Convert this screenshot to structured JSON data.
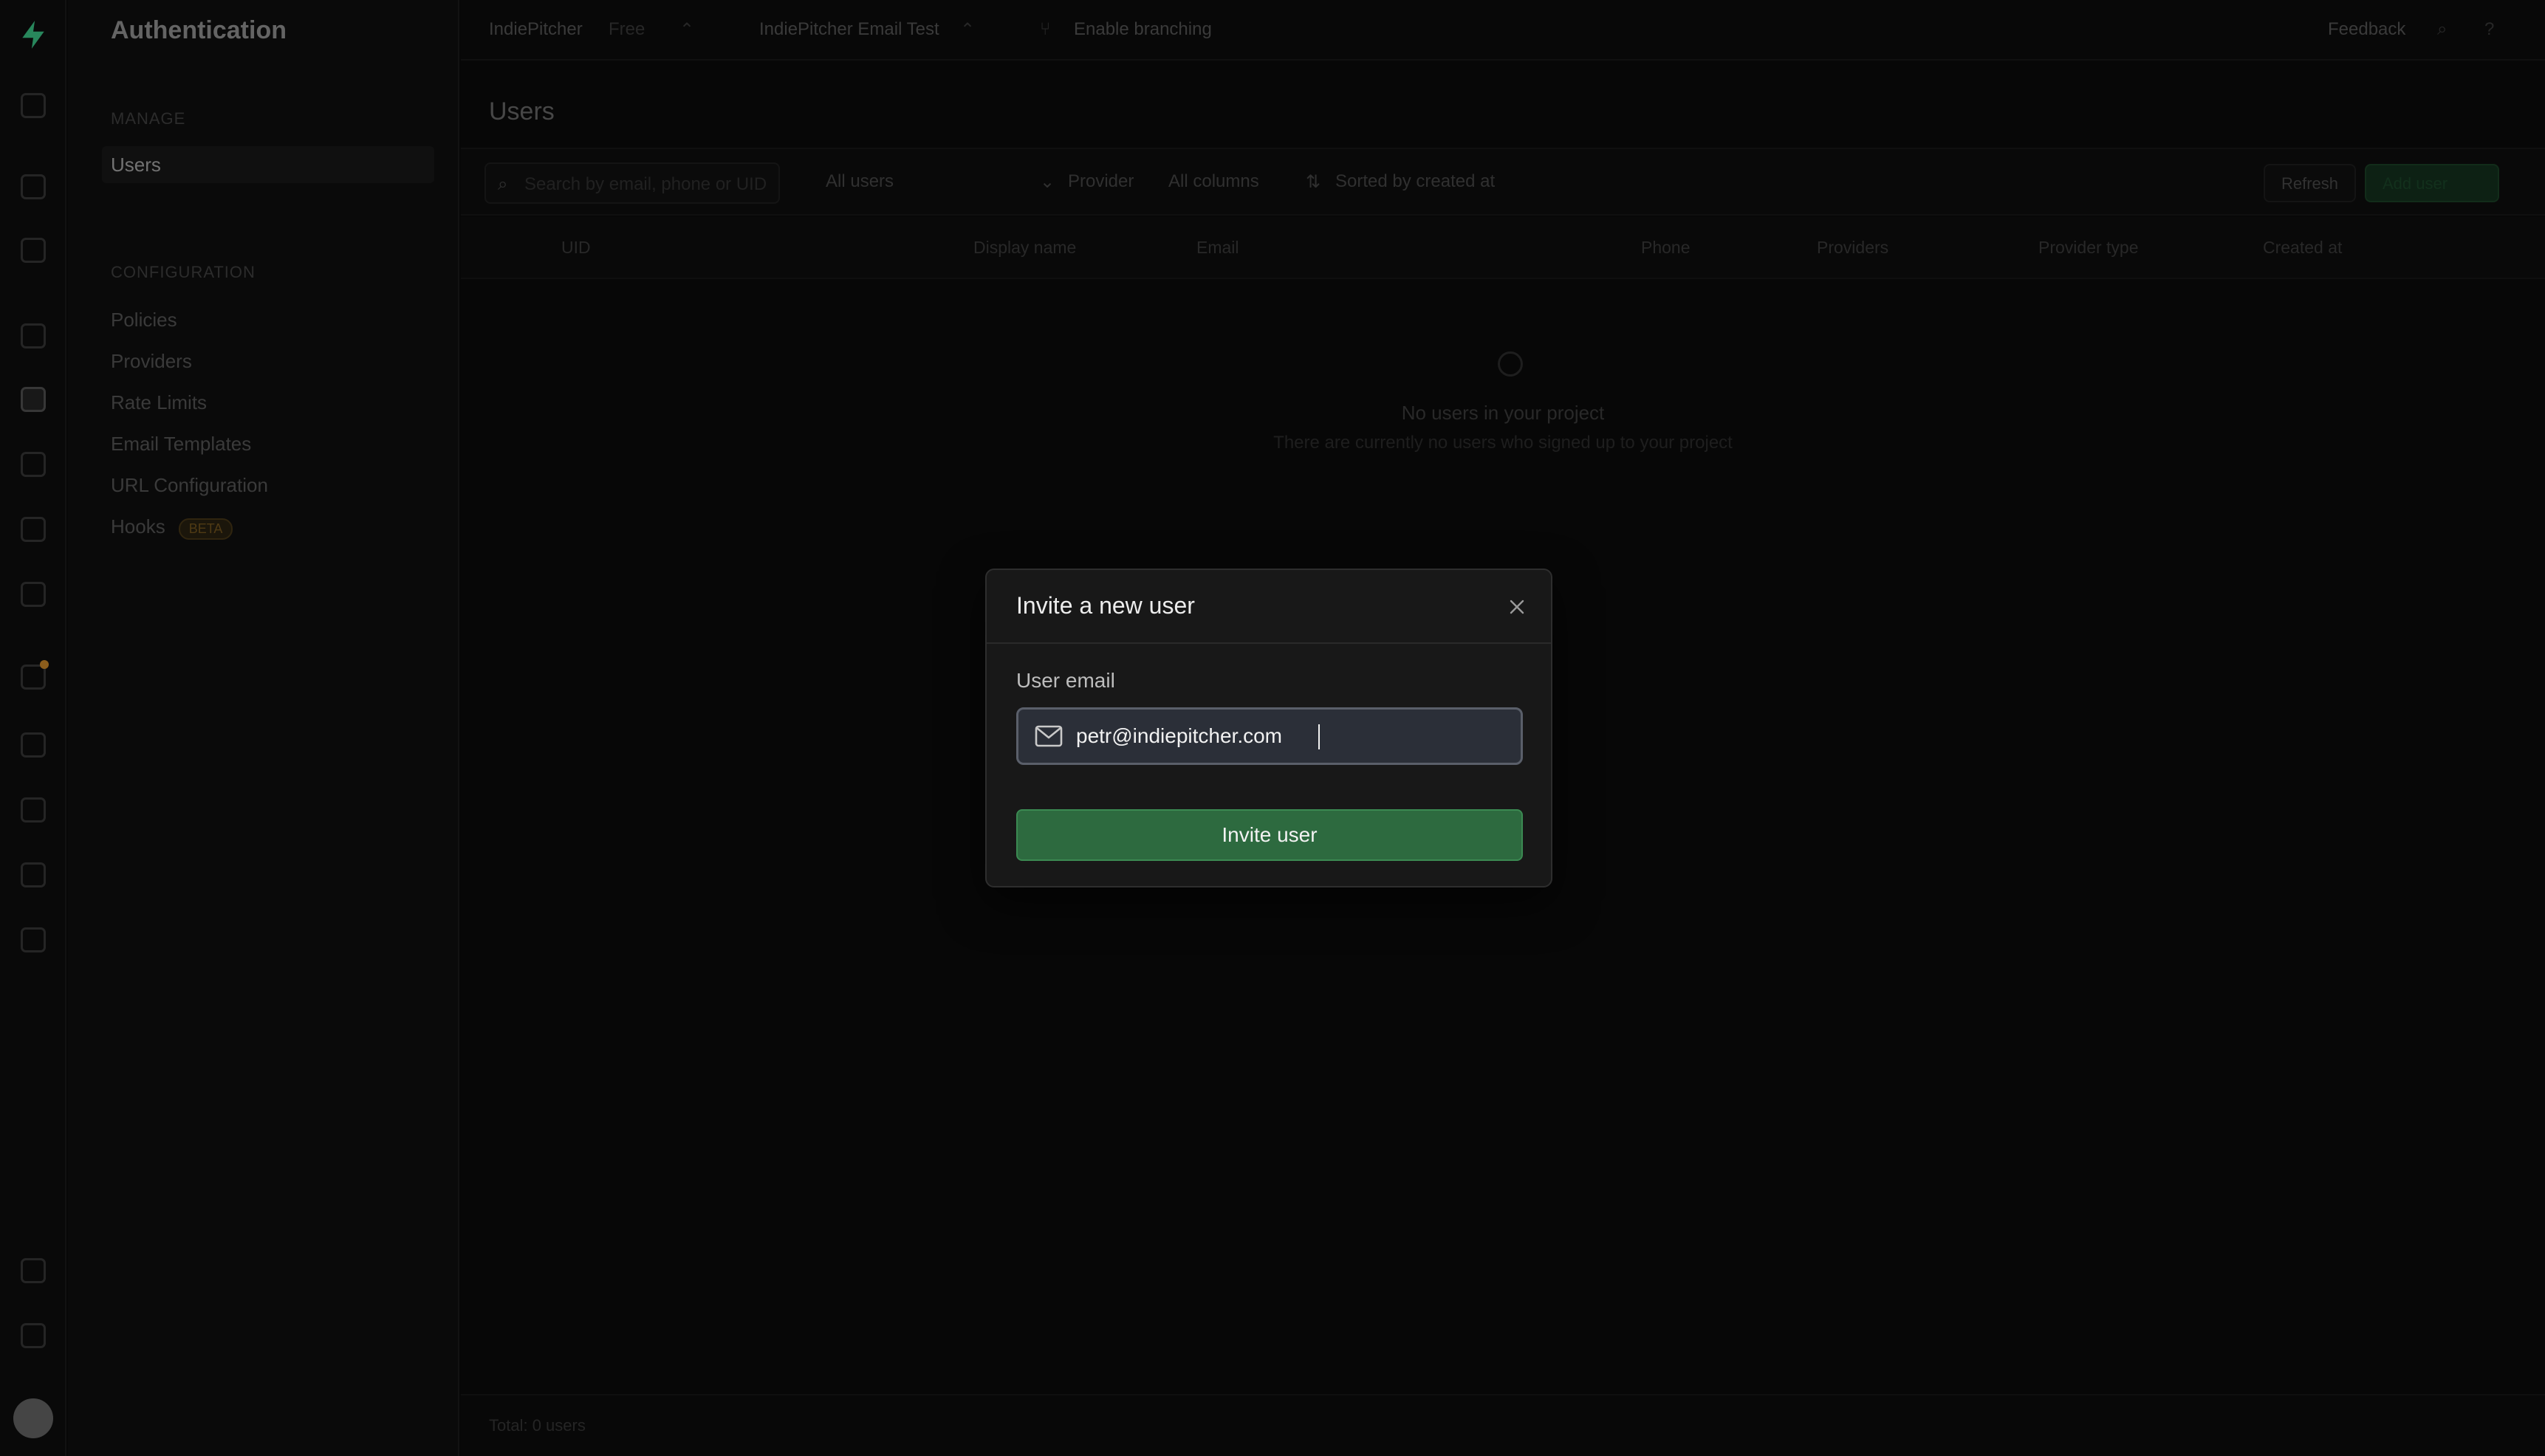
{
  "sidebar": {
    "title": "Authentication",
    "section_manage": "MANAGE",
    "users": "Users",
    "section_config": "CONFIGURATION",
    "items": [
      "Policies",
      "Providers",
      "Rate Limits",
      "Email Templates",
      "URL Configuration",
      "Hooks"
    ],
    "hooks_badge": "BETA"
  },
  "topbar": {
    "org": "IndiePitcher",
    "plan": "Free",
    "project": "IndiePitcher Email Test",
    "branching": "Enable branching",
    "feedback": "Feedback"
  },
  "main": {
    "title": "Users",
    "search_placeholder": "Search by email, phone or UID",
    "filter_users": "All users",
    "provider": "Provider",
    "columns": "All columns",
    "sort": "Sorted by created at",
    "refresh": "Refresh",
    "add_user": "Add user",
    "headers": [
      "UID",
      "Display name",
      "Email",
      "Phone",
      "Providers",
      "Provider type",
      "Created at"
    ],
    "empty_title": "No users in your project",
    "empty_sub": "There are currently no users who signed up to your project",
    "total": "Total: 0 users"
  },
  "modal": {
    "title": "Invite a new user",
    "label": "User email",
    "email_value": "petr@indiepitcher.com",
    "button": "Invite user"
  },
  "colors": {
    "accent_green": "#2d6a3f",
    "modal_bg": "#181818",
    "input_bg": "#2b2f38"
  }
}
